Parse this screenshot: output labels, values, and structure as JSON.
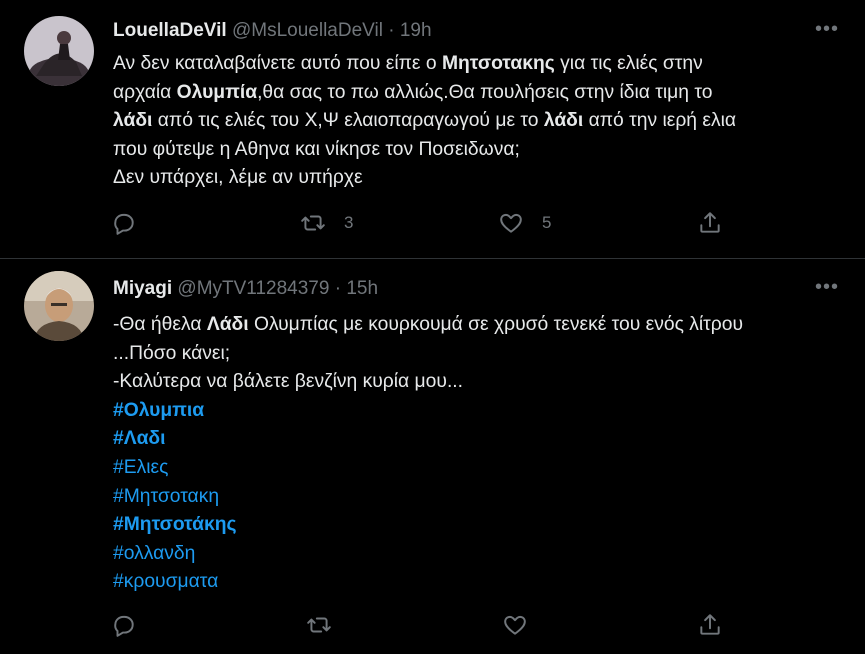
{
  "tweets": [
    {
      "name": "LouellaDeVil",
      "handle": "@MsLouellaDeVil",
      "separator": "·",
      "time": "19h",
      "more": "•••",
      "lines": [
        [
          "Αν δεν καταλαβαίνετε αυτό που είπε ο ",
          "Μητσοτακης",
          " για τις ελιές στην"
        ],
        [
          "αρχαία ",
          "Ολυμπία",
          ",θα σας το πω αλλιώς.Θα πουλήσεις στην ίδια τιμη το"
        ],
        [
          "λάδι",
          " από τις ελιές του Χ,Ψ ελαιοπαραγωγού με το ",
          "λάδι",
          " από την ιερή ελια"
        ],
        [
          "που φύτεψε η Αθηνα και νίκησε τον Ποσειδωνα;"
        ],
        [
          "Δεν υπάρχει, λέμε αν υπήρχε"
        ]
      ],
      "retweets": "3",
      "likes": "5"
    },
    {
      "name": "Miyagi",
      "handle": "@MyTV11284379",
      "separator": "·",
      "time": "15h",
      "more": "•••",
      "lines": [
        [
          "-Θα ήθελα ",
          "Λάδι",
          " Ολυμπίας με κουρκουμά σε χρυσό τενεκέ του ενός λίτρου"
        ],
        [
          "...Πόσο κάνει;"
        ],
        [
          "-Καλύτερα να βάλετε βενζίνη κυρία μου..."
        ]
      ],
      "hashtags": [
        "#Ολυμπια",
        "#Λαδι",
        "#Ελιες",
        "#Μητσοτακη",
        "#Μητσοτάκης",
        "#ολλανδη",
        "#κρουσματα"
      ]
    }
  ],
  "colors": {
    "link": "#1d9bf0",
    "muted": "#71767b",
    "text": "#e7e9ea",
    "bg": "#000000"
  },
  "icons": [
    "reply-icon",
    "retweet-icon",
    "like-icon",
    "share-icon",
    "more-icon"
  ]
}
